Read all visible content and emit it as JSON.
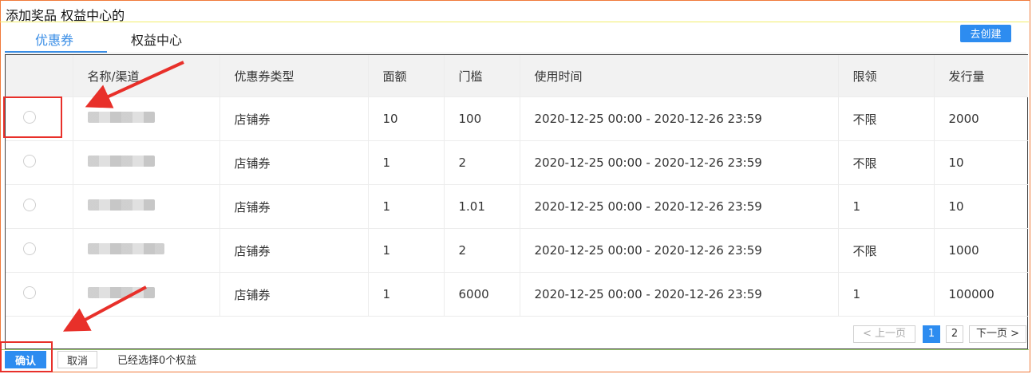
{
  "header": {
    "title": "添加奖品 权益中心的"
  },
  "tabs": [
    {
      "label": "优惠券",
      "active": true
    },
    {
      "label": "权益中心",
      "active": false
    }
  ],
  "create_button": {
    "label": "去创建"
  },
  "table": {
    "columns": [
      "",
      "名称/渠道",
      "优惠券类型",
      "面额",
      "门槛",
      "使用时间",
      "限领",
      "发行量"
    ],
    "rows": [
      {
        "type": "店铺券",
        "face": "10",
        "threshold": "100",
        "time": "2020-12-25 00:00 - 2020-12-26 23:59",
        "limit": "不限",
        "qty": "2000"
      },
      {
        "type": "店铺券",
        "face": "1",
        "threshold": "2",
        "time": "2020-12-25 00:00 - 2020-12-26 23:59",
        "limit": "不限",
        "qty": "10"
      },
      {
        "type": "店铺券",
        "face": "1",
        "threshold": "1.01",
        "time": "2020-12-25 00:00 - 2020-12-26 23:59",
        "limit": "1",
        "qty": "10"
      },
      {
        "type": "店铺券",
        "face": "1",
        "threshold": "2",
        "time": "2020-12-25 00:00 - 2020-12-26 23:59",
        "limit": "不限",
        "qty": "1000"
      },
      {
        "type": "店铺券",
        "face": "1",
        "threshold": "6000",
        "time": "2020-12-25 00:00 - 2020-12-26 23:59",
        "limit": "1",
        "qty": "100000"
      }
    ]
  },
  "pagination": {
    "prev": "< 上一页",
    "pages": [
      "1",
      "2"
    ],
    "current": "1",
    "next": "下一页 >"
  },
  "footer": {
    "confirm": "确认",
    "cancel": "取消",
    "selected_text": "已经选择0个权益"
  },
  "colors": {
    "accent": "#2d8cf0",
    "annotation": "#e8302a"
  }
}
